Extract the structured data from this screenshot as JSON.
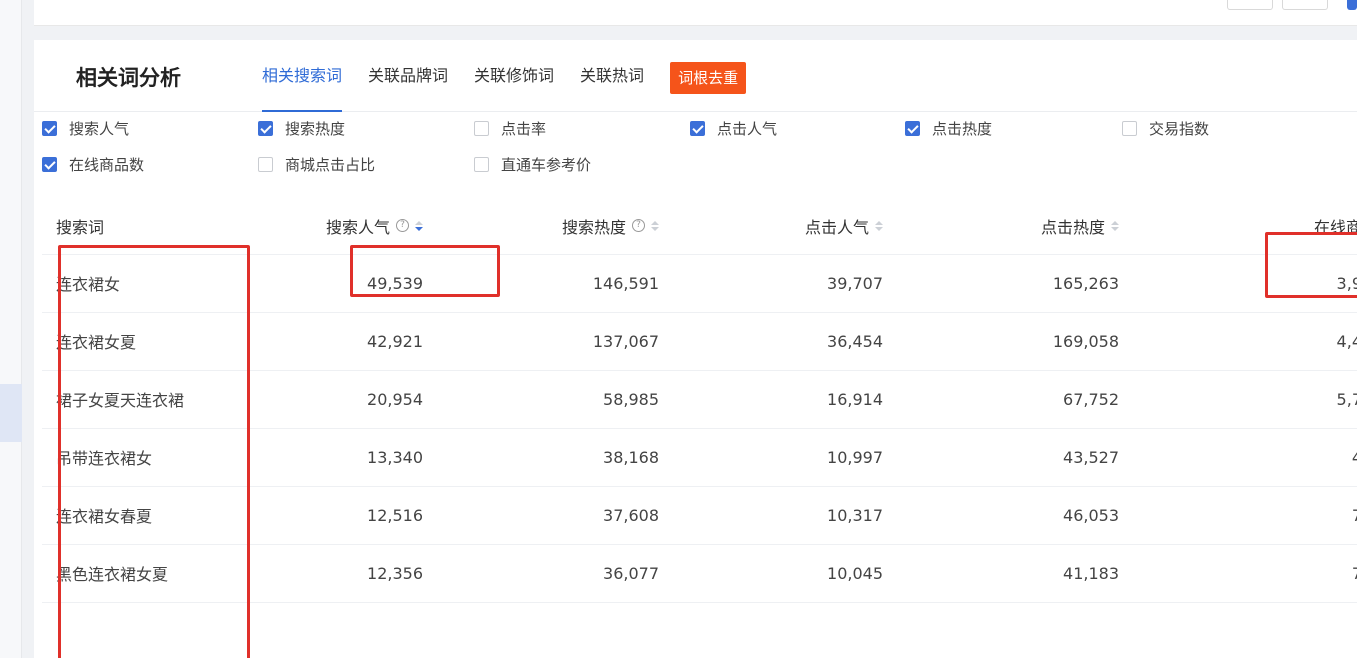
{
  "title": "相关词分析",
  "tabs": [
    {
      "label": "相关搜索词",
      "active": true
    },
    {
      "label": "关联品牌词"
    },
    {
      "label": "关联修饰词"
    },
    {
      "label": "关联热词"
    },
    {
      "label": "词根去重",
      "badge": true
    }
  ],
  "filters": [
    {
      "label": "搜索人气",
      "checked": true
    },
    {
      "label": "搜索热度",
      "checked": true
    },
    {
      "label": "点击率",
      "checked": false
    },
    {
      "label": "点击人气",
      "checked": true
    },
    {
      "label": "点击热度",
      "checked": true
    },
    {
      "label": "交易指数",
      "checked": false
    },
    {
      "label": "在线商品数",
      "checked": true
    },
    {
      "label": "商城点击占比",
      "checked": false
    },
    {
      "label": "直通车参考价",
      "checked": false
    }
  ],
  "table": {
    "headers": [
      "搜索词",
      "搜索人气",
      "搜索热度",
      "点击人气",
      "点击热度",
      "在线商"
    ],
    "rows": [
      [
        "连衣裙女",
        "49,539",
        "146,591",
        "39,707",
        "165,263",
        "3,9"
      ],
      [
        "连衣裙女夏",
        "42,921",
        "137,067",
        "36,454",
        "169,058",
        "4,4"
      ],
      [
        "裙子女夏天连衣裙",
        "20,954",
        "58,985",
        "16,914",
        "67,752",
        "5,7"
      ],
      [
        "吊带连衣裙女",
        "13,340",
        "38,168",
        "10,997",
        "43,527",
        "4"
      ],
      [
        "连衣裙女春夏",
        "12,516",
        "37,608",
        "10,317",
        "46,053",
        "7"
      ],
      [
        "黑色连衣裙女夏",
        "12,356",
        "36,077",
        "10,045",
        "41,183",
        "7"
      ]
    ]
  },
  "colors": {
    "accent": "#2f6bd6",
    "badge": "#f5541a",
    "highlight_box": "#e0302a"
  }
}
